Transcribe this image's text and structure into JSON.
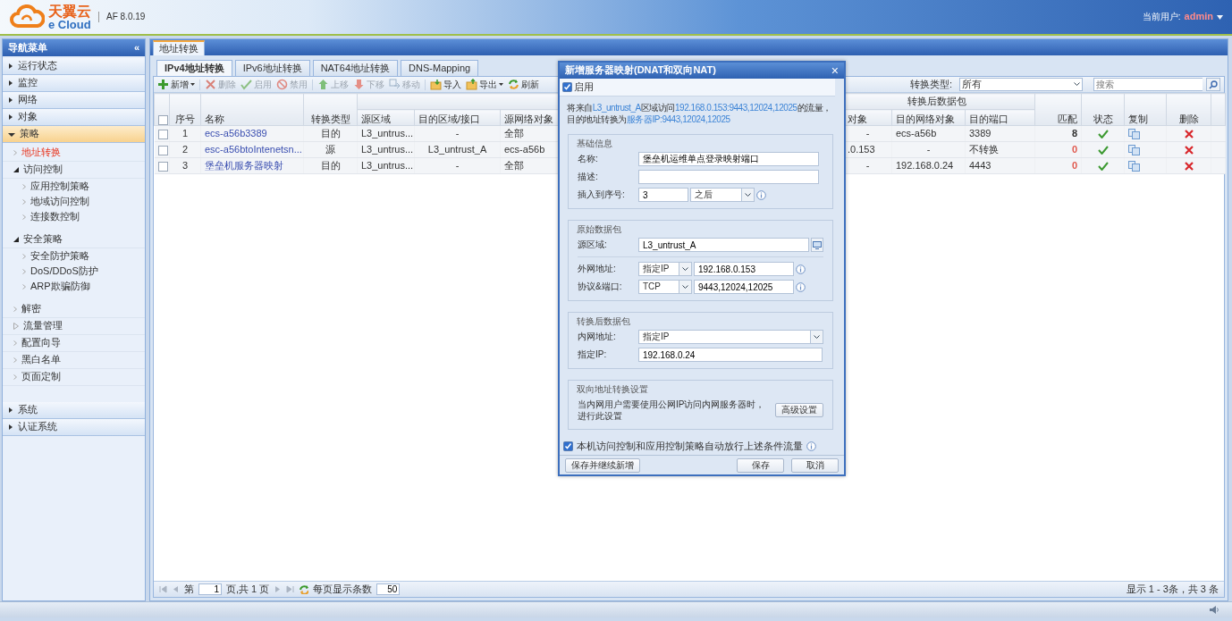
{
  "header": {
    "logo_title": "天翼云",
    "logo_subtitle": "e Cloud",
    "version": "AF 8.0.19",
    "user_label": "当前用户:",
    "user": "admin"
  },
  "sidebar": {
    "title": "导航菜单",
    "collapse": "«",
    "sections": [
      {
        "label": "运行状态",
        "expanded": false,
        "selected": false
      },
      {
        "label": "监控",
        "expanded": false,
        "selected": false
      },
      {
        "label": "网络",
        "expanded": false,
        "selected": false
      },
      {
        "label": "对象",
        "expanded": false,
        "selected": false
      },
      {
        "label": "策略",
        "expanded": true,
        "selected": true,
        "children": [
          {
            "label": "地址转换",
            "kind": "link",
            "selected": true
          },
          {
            "label": "访问控制",
            "kind": "group",
            "expanded": true,
            "selected": false,
            "children": [
              {
                "label": "应用控制策略",
                "kind": "link",
                "selected": false
              },
              {
                "label": "地域访问控制",
                "kind": "link",
                "selected": false
              },
              {
                "label": "连接数控制",
                "kind": "link",
                "selected": false
              }
            ]
          },
          {
            "label": "安全策略",
            "kind": "group",
            "expanded": true,
            "selected": false,
            "children": [
              {
                "label": "安全防护策略",
                "kind": "link",
                "selected": false
              },
              {
                "label": "DoS/DDoS防护",
                "kind": "link",
                "selected": false
              },
              {
                "label": "ARP欺骗防御",
                "kind": "link",
                "selected": false
              }
            ]
          },
          {
            "label": "解密",
            "kind": "link",
            "selected": false
          },
          {
            "label": "流量管理",
            "kind": "group",
            "expanded": false,
            "selected": false
          },
          {
            "label": "配置向导",
            "kind": "link",
            "selected": false
          },
          {
            "label": "黑白名单",
            "kind": "link",
            "selected": false
          },
          {
            "label": "页面定制",
            "kind": "link",
            "selected": false
          }
        ]
      },
      {
        "label": "系统",
        "expanded": false,
        "selected": false
      },
      {
        "label": "认证系统",
        "expanded": false,
        "selected": false
      }
    ]
  },
  "main_tabs": [
    {
      "label": "地址转换",
      "selected": true
    }
  ],
  "sub_tabs": [
    {
      "label": "IPv4地址转换",
      "selected": true
    },
    {
      "label": "IPv6地址转换",
      "selected": false
    },
    {
      "label": "NAT64地址转换",
      "selected": false
    },
    {
      "label": "DNS-Mapping",
      "selected": false
    }
  ],
  "toolbar": [
    {
      "label": "新增",
      "kind": "add",
      "disabled": false,
      "dropdown": true
    },
    {
      "label": "删除",
      "kind": "delete",
      "disabled": true,
      "dropdown": false
    },
    {
      "label": "启用",
      "kind": "enable",
      "disabled": true,
      "dropdown": false
    },
    {
      "label": "禁用",
      "kind": "disable",
      "disabled": true,
      "dropdown": false
    },
    {
      "label": "上移",
      "kind": "up",
      "disabled": true,
      "dropdown": false
    },
    {
      "label": "下移",
      "kind": "down",
      "disabled": true,
      "dropdown": false
    },
    {
      "label": "移动",
      "kind": "move",
      "disabled": true,
      "dropdown": false
    },
    {
      "label": "导入",
      "kind": "import",
      "disabled": false,
      "dropdown": false
    },
    {
      "label": "导出",
      "kind": "export",
      "disabled": false,
      "dropdown": true
    },
    {
      "label": "刷新",
      "kind": "refresh",
      "disabled": false,
      "dropdown": false
    }
  ],
  "filter": {
    "label": "转换类型:",
    "value": "所有",
    "search_placeholder": "搜索"
  },
  "table": {
    "header_checked": false,
    "group_header": "转换后数据包",
    "columns": [
      "序号",
      "名称",
      "转换类型",
      "源区域",
      "目的区域/接口",
      "源网络对象",
      "对象",
      "目的网络对象",
      "目的端口",
      "匹配",
      "状态",
      "复制",
      "删除"
    ],
    "rows": [
      {
        "checked": false,
        "cells": [
          "1",
          "ecs-a56b3389",
          "目的",
          "L3_untrus...",
          "-",
          "全部",
          "-",
          "ecs-a56b",
          "3389"
        ],
        "match": {
          "text": "8",
          "color": "#333333"
        },
        "enabled": true
      },
      {
        "checked": false,
        "cells": [
          "2",
          "esc-a56btoIntenetsn...",
          "源",
          "L3_untrus...",
          "L3_untrust_A",
          "ecs-a56b",
          ".0.153",
          "-",
          "不转换"
        ],
        "match": {
          "text": "0",
          "color": "#e05a4f"
        },
        "enabled": true
      },
      {
        "checked": false,
        "cells": [
          "3",
          "堡垒机服务器映射",
          "目的",
          "L3_untrus...",
          "-",
          "全部",
          "-",
          "192.168.0.24",
          "4443"
        ],
        "match": {
          "text": "0",
          "color": "#e05a4f"
        },
        "enabled": true
      }
    ]
  },
  "pager": {
    "page_prefix": "第",
    "page": "1",
    "page_suffix": "页,共 1 页",
    "per_page_label": "每页显示条数",
    "per_page": "50",
    "summary": "显示 1 - 3条，共 3 条"
  },
  "dialog": {
    "title": "新增服务器映射(DNAT和双向NAT)",
    "close": "×",
    "enable": {
      "label": "启用",
      "checked": true
    },
    "summary": [
      [
        {
          "text": "将来自",
          "kind": "text"
        },
        {
          "text": "L3_untrust_A",
          "kind": "link"
        },
        {
          "text": "区域访问",
          "kind": "text"
        },
        {
          "text": "192.168.0.153:9443,12024,12025",
          "kind": "link"
        },
        {
          "text": "的流量，",
          "kind": "text"
        }
      ],
      [
        {
          "text": "目的地址转换为",
          "kind": "text"
        },
        {
          "text": "服务器IP:9443,12024,12025",
          "kind": "link"
        }
      ]
    ],
    "fieldsets": [
      {
        "legend": "基础信息",
        "rows": [
          {
            "kind": "text",
            "label": "名称:",
            "value": "堡垒机运维单点登录映射端口"
          },
          {
            "kind": "text",
            "label": "描述:"
          },
          {
            "kind": "text_select",
            "label": "插入到序号:",
            "value": "3",
            "option": "之后"
          }
        ]
      },
      {
        "legend": "原始数据包",
        "rows": [
          {
            "kind": "picker",
            "label": "源区域:",
            "value": "L3_untrust_A"
          },
          {
            "kind": "divider"
          },
          {
            "kind": "select_text",
            "label": "外网地址:",
            "option": "指定IP",
            "value": "192.168.0.153"
          },
          {
            "kind": "select_text",
            "label": "协议&端口:",
            "option": "TCP",
            "value": "9443,12024,12025"
          }
        ]
      },
      {
        "legend": "转换后数据包",
        "rows": [
          {
            "kind": "select",
            "label": "内网地址:",
            "option": "指定IP"
          },
          {
            "kind": "text",
            "label": "指定IP:",
            "value": "192.168.0.24"
          }
        ]
      },
      {
        "legend": "双向地址转换设置",
        "rows": [
          {
            "kind": "note",
            "text": "当内网用户需要使用公网IP访问内网服务器时，进行此设置",
            "button": "高级设置"
          }
        ]
      }
    ],
    "auto_allow": {
      "label": "本机访问控制和应用控制策略自动放行上述条件流量",
      "checked": true
    },
    "buttons": [
      {
        "label": "保存并继续新增"
      },
      {
        "label": "保存"
      },
      {
        "label": "取消"
      }
    ]
  }
}
